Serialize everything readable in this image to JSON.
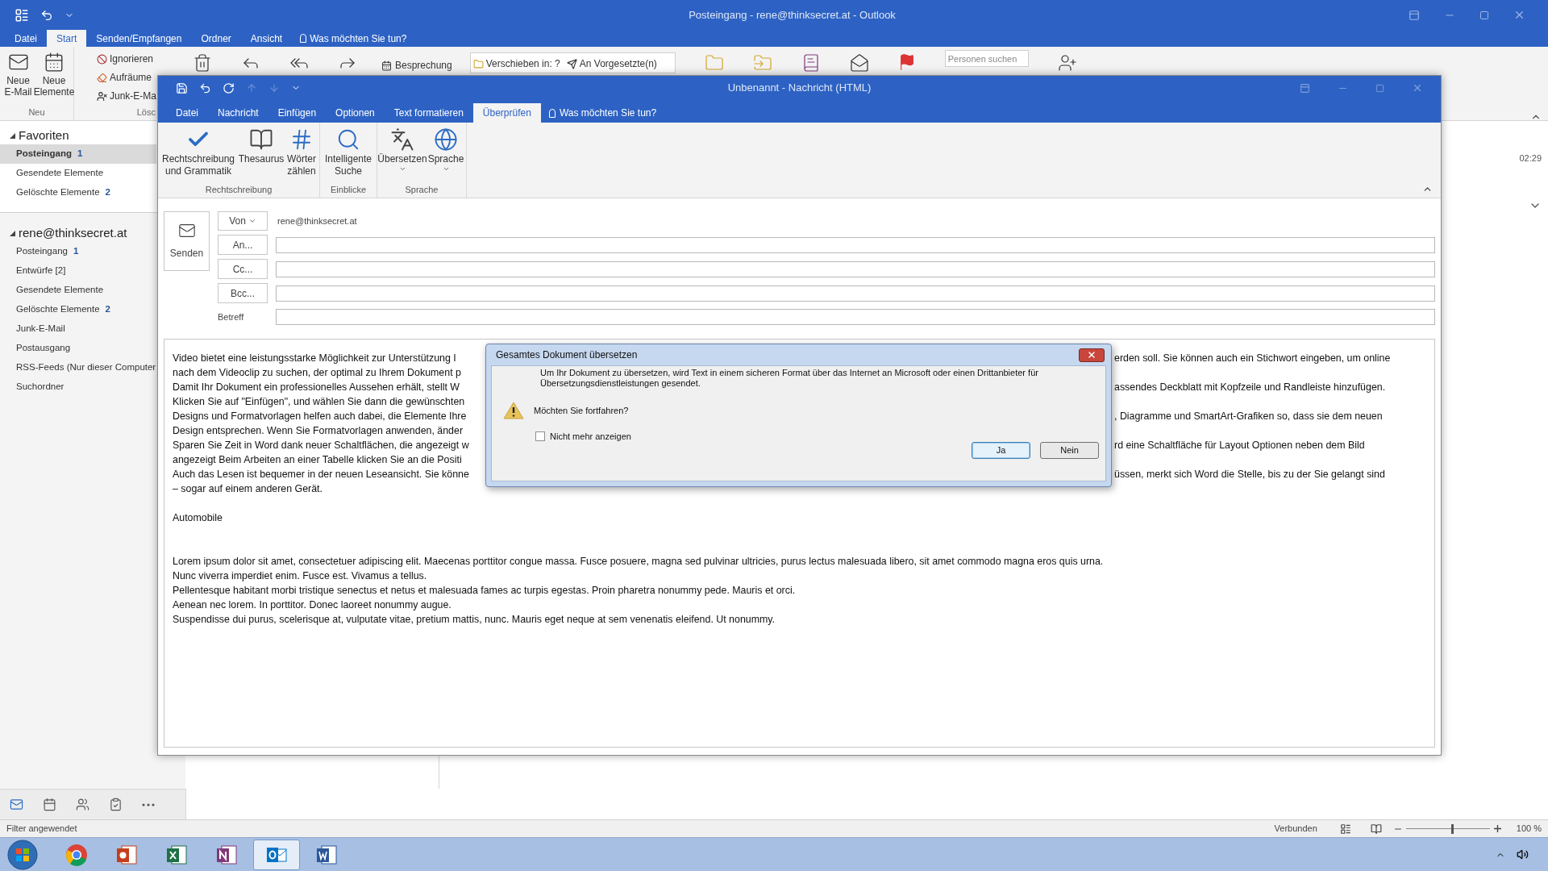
{
  "outlook": {
    "title": "Posteingang - rene@thinksecret.at - Outlook",
    "tabs": [
      {
        "label": "Datei",
        "selected": false
      },
      {
        "label": "Start",
        "selected": true
      },
      {
        "label": "Senden/Empfangen",
        "selected": false
      },
      {
        "label": "Ordner",
        "selected": false
      },
      {
        "label": "Ansicht",
        "selected": false
      }
    ],
    "tell_me": "Was möchten Sie tun?",
    "ribbon": {
      "new_email": "Neue E-Mail",
      "new_items": "Neue Elemente",
      "group_new": "Neu",
      "ignore": "Ignorieren",
      "cleanup": "Aufräume",
      "junk": "Junk-E-Ma",
      "group_delete": "Lösc",
      "meeting": "Besprechung",
      "quick_steps": [
        "Verschieben in: ?",
        "An Vorgesetzte(n)"
      ],
      "people_search": {
        "placeholder": "Personen suchen"
      }
    },
    "folders": [
      {
        "label": "Favoriten",
        "expanded": true,
        "items": [
          {
            "name": "Posteingang",
            "count": "1",
            "selected": true
          },
          {
            "name": "Gesendete Elemente",
            "selected": false
          },
          {
            "name": "Gelöschte Elemente",
            "count": "2",
            "selected": false
          }
        ]
      },
      {
        "label": "rene@thinksecret.at",
        "expanded": true,
        "items": [
          {
            "name": "Posteingang",
            "count": "1",
            "selected": false
          },
          {
            "name": "Entwürfe [2]",
            "selected": false
          },
          {
            "name": "Gesendete Elemente",
            "selected": false
          },
          {
            "name": "Gelöschte Elemente",
            "count": "2",
            "selected": false
          },
          {
            "name": "Junk-E-Mail",
            "selected": false
          },
          {
            "name": "Postausgang",
            "selected": false
          },
          {
            "name": "RSS-Feeds (Nur dieser Computer",
            "selected": false
          },
          {
            "name": "Suchordner",
            "selected": false
          }
        ]
      }
    ],
    "time": "02:29",
    "nav": [
      {
        "kind": "mail",
        "selected": true
      },
      {
        "kind": "calendar",
        "selected": false
      },
      {
        "kind": "people",
        "selected": false
      },
      {
        "kind": "tasks",
        "selected": false
      },
      {
        "kind": "more",
        "selected": false
      }
    ],
    "status_bar": {
      "filter": "Filter angewendet",
      "connection": "Verbunden",
      "zoom": "100 %",
      "level": 0.55
    }
  },
  "compose": {
    "title": "Unbenannt - Nachricht (HTML)",
    "tabs": [
      {
        "label": "Datei",
        "selected": false
      },
      {
        "label": "Nachricht",
        "selected": false
      },
      {
        "label": "Einfügen",
        "selected": false
      },
      {
        "label": "Optionen",
        "selected": false
      },
      {
        "label": "Text formatieren",
        "selected": false
      },
      {
        "label": "Überprüfen",
        "selected": true
      }
    ],
    "tell_me": "Was möchten Sie tun?",
    "ribbon_groups": [
      {
        "label": "Rechtschreibung",
        "buttons": [
          {
            "label": "Rechtschreibung und Grammatik",
            "kind": "spelling",
            "dropdown": false
          },
          {
            "label": "Thesaurus",
            "kind": "thesaurus",
            "dropdown": false
          },
          {
            "label": "Wörter zählen",
            "kind": "count",
            "dropdown": false
          }
        ]
      },
      {
        "label": "Einblicke",
        "buttons": [
          {
            "label": "Intelligente Suche",
            "kind": "smart",
            "dropdown": false
          }
        ]
      },
      {
        "label": "Sprache",
        "buttons": [
          {
            "label": "Übersetzen",
            "kind": "translate",
            "dropdown": true
          },
          {
            "label": "Sprache",
            "kind": "language",
            "dropdown": true
          }
        ]
      }
    ],
    "send": "Senden",
    "from": {
      "label": "Von",
      "value": "rene@thinksecret.at"
    },
    "recipients": [
      {
        "label": "An..."
      },
      {
        "label": "Cc..."
      },
      {
        "label": "Bcc..."
      }
    ],
    "subject": {
      "label": "Betreff"
    },
    "body": {
      "lines": [
        {
          "left": "Video bietet eine leistungsstarke Möglichkeit zur Unterstützung I",
          "right": "erden soll. Sie können auch ein Stichwort eingeben, um online"
        },
        {
          "left": "nach dem Videoclip zu suchen, der optimal zu Ihrem Dokument p"
        },
        {
          "left": "Damit Ihr Dokument ein professionelles Aussehen erhält, stellt W",
          "right": "assendes Deckblatt mit Kopfzeile und Randleiste hinzufügen."
        },
        {
          "left": "Klicken Sie auf \"Einfügen\", und wählen Sie dann die gewünschten"
        },
        {
          "left": "Designs und Formatvorlagen helfen auch dabei, die Elemente Ihre",
          "right": ", Diagramme und SmartArt-Grafiken so, dass sie dem neuen"
        },
        {
          "left": "Design entsprechen. Wenn Sie Formatvorlagen anwenden, änder"
        },
        {
          "left": "Sparen Sie Zeit in Word dank neuer Schaltflächen, die angezeigt w",
          "right": "rd eine Schaltfläche für Layout Optionen neben dem Bild"
        },
        {
          "left": "angezeigt Beim Arbeiten an einer Tabelle klicken Sie an die Positi"
        },
        {
          "left": "Auch das Lesen ist bequemer in der neuen Leseansicht. Sie könne",
          "right": "üssen, merkt sich Word die Stelle, bis zu der Sie gelangt sind"
        },
        {
          "left": "– sogar auf einem anderen Gerät."
        }
      ],
      "heading": "Automobile",
      "paragraph": [
        "Lorem ipsum dolor sit amet, consectetuer adipiscing elit. Maecenas porttitor congue massa. Fusce posuere, magna sed pulvinar ultricies, purus lectus malesuada libero, sit amet commodo magna eros quis urna.",
        "Nunc viverra imperdiet enim. Fusce est. Vivamus a tellus.",
        "Pellentesque habitant morbi tristique senectus et netus et malesuada fames ac turpis egestas. Proin pharetra nonummy pede. Mauris et orci.",
        "Aenean nec lorem. In porttitor. Donec laoreet nonummy augue.",
        "Suspendisse dui purus, scelerisque at, vulputate vitae, pretium mattis, nunc. Mauris eget neque at sem venenatis eleifend. Ut nonummy."
      ]
    }
  },
  "dialog": {
    "title": "Gesamtes Dokument übersetzen",
    "message": "Um Ihr Dokument zu übersetzen, wird Text in einem sicheren Format über das Internet an Microsoft oder einen Drittanbieter für Übersetzungsdienstleistungen gesendet.",
    "question": "Möchten Sie fortfahren?",
    "checkbox": {
      "label": "Nicht mehr anzeigen",
      "checked": false
    },
    "buttons": [
      {
        "label": "Ja",
        "default": true
      },
      {
        "label": "Nein",
        "default": false
      }
    ]
  },
  "taskbar": [
    {
      "kind": "chrome",
      "active": false
    },
    {
      "kind": "powerpoint",
      "active": false
    },
    {
      "kind": "excel",
      "active": false
    },
    {
      "kind": "onenote",
      "active": false
    },
    {
      "kind": "outlook",
      "active": true
    },
    {
      "kind": "word",
      "active": false
    }
  ]
}
